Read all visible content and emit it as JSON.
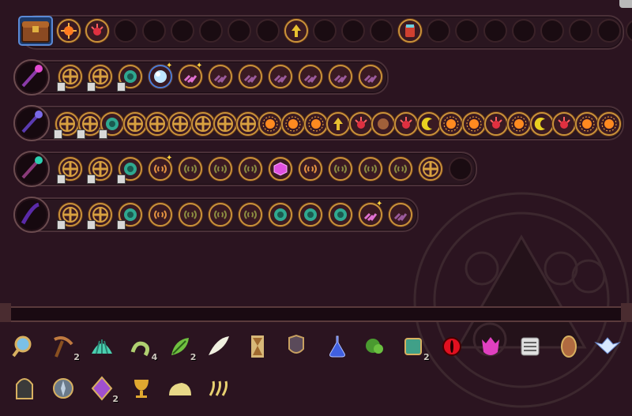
{
  "inventory": {
    "item_counts": {
      "pickaxe": "2",
      "worm": "4",
      "leaf": "2",
      "emerald_cube": "2",
      "purple_gem": "2"
    }
  },
  "colors": {
    "background": "#2b1420",
    "slot_border": "#c9923a",
    "row_frame": "#4a3038"
  }
}
